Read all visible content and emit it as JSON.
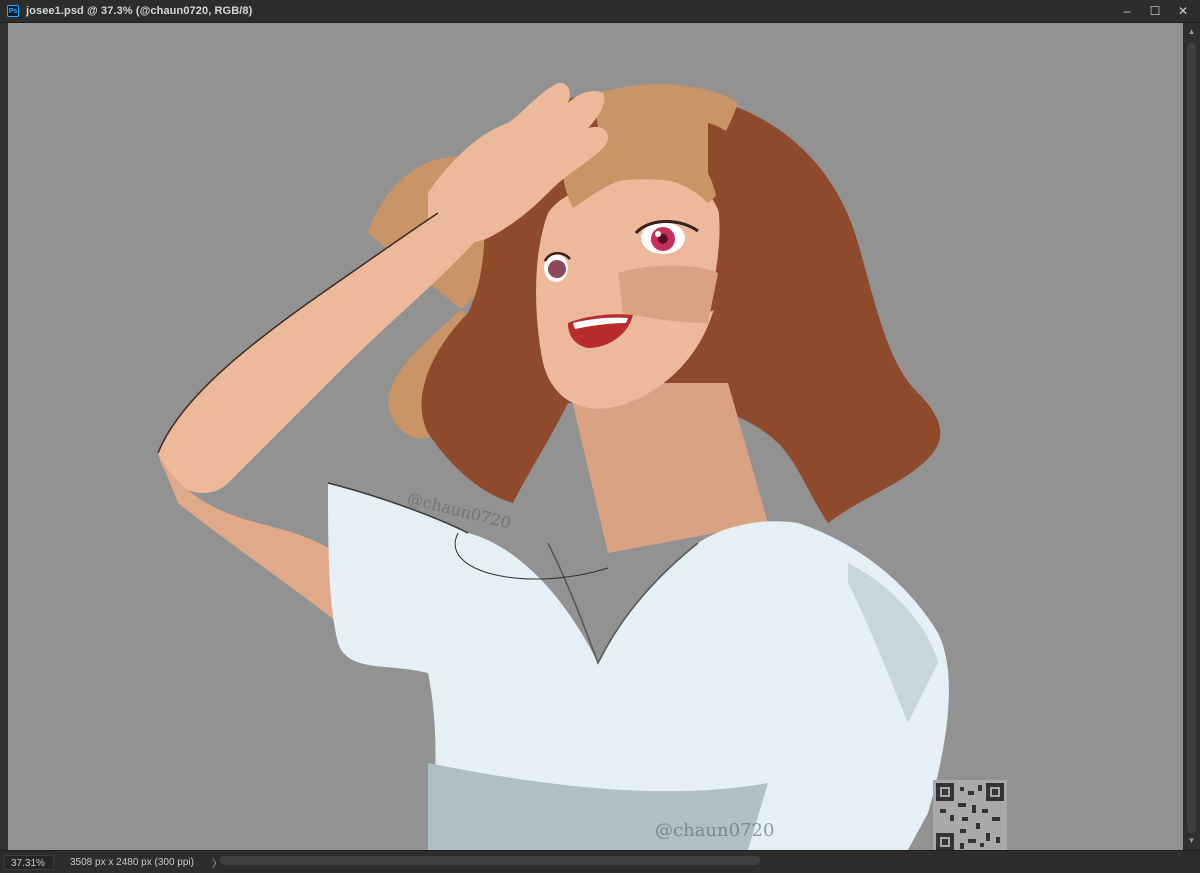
{
  "window": {
    "title": "josee1.psd @ 37.3% (@chaun0720, RGB/8)",
    "app_icon": "Ps",
    "controls": {
      "minimize": "–",
      "maximize": "☐",
      "close": "✕"
    }
  },
  "canvas": {
    "background": "#929292",
    "artwork": "anime-style illustration of a girl with wavy auburn hair shading her eyes with her hand",
    "watermarks": [
      "@chaun0720",
      "@chaun0720"
    ]
  },
  "statusbar": {
    "zoom": "37.31%",
    "doc_info": "3508 px x 2480 px (300 ppi)",
    "arrow": "〉"
  },
  "colors": {
    "hair": "#8e4a2b",
    "hair_light": "#c99566",
    "skin": "#edb99b",
    "skin_shadow": "#d9a283",
    "shirt": "#e4f0f5",
    "shirt_shadow": "#aebfc6",
    "eye": "#c7305a"
  }
}
